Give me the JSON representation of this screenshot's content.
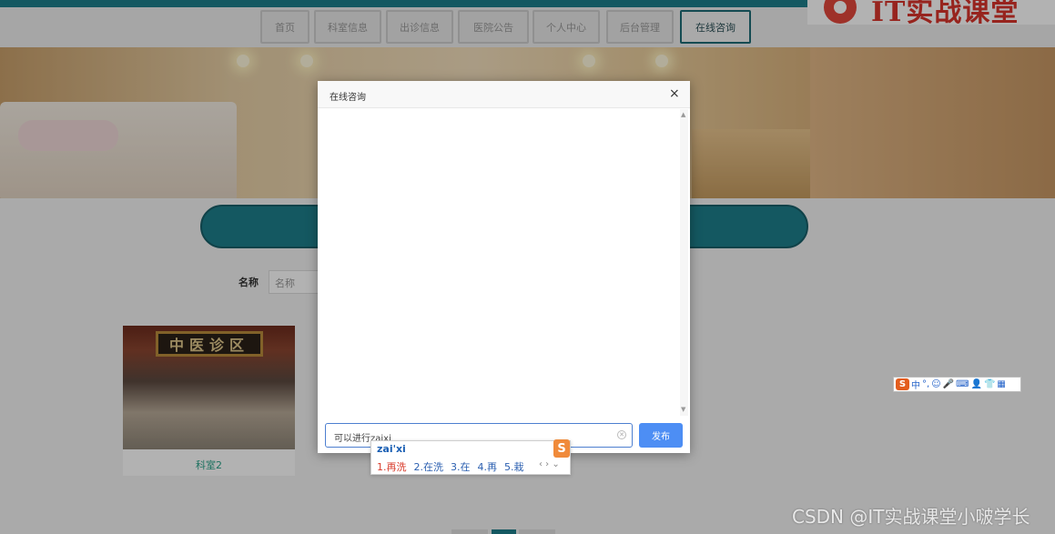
{
  "nav": {
    "items": [
      "首页",
      "科室信息",
      "出诊信息",
      "医院公告",
      "个人中心",
      "后台管理",
      "在线咨询"
    ],
    "active": "在线咨询"
  },
  "logo": {
    "text": "IT实战课堂"
  },
  "search": {
    "label": "名称",
    "placeholder": "名称"
  },
  "card": {
    "title": "科室2",
    "sign_text": "中医诊区"
  },
  "modal": {
    "title": "在线咨询",
    "close_symbol": "×",
    "input_value": "可以进行zaixi",
    "publish_label": "发布"
  },
  "ime": {
    "composition": "zai'xi",
    "candidates": [
      "1.再洗",
      "2.在洗",
      "3.在",
      "4.再",
      "5.栽"
    ],
    "logo": "S",
    "toolbar": [
      "中",
      "°,",
      "☺",
      "🎤",
      "⌨",
      "👤",
      "👕",
      "▦"
    ]
  },
  "watermark": "CSDN @IT实战课堂小啵学长",
  "colors": {
    "accent": "#1e7e8b",
    "publish": "#4d8ef4",
    "ime_red": "#d93b2b"
  }
}
